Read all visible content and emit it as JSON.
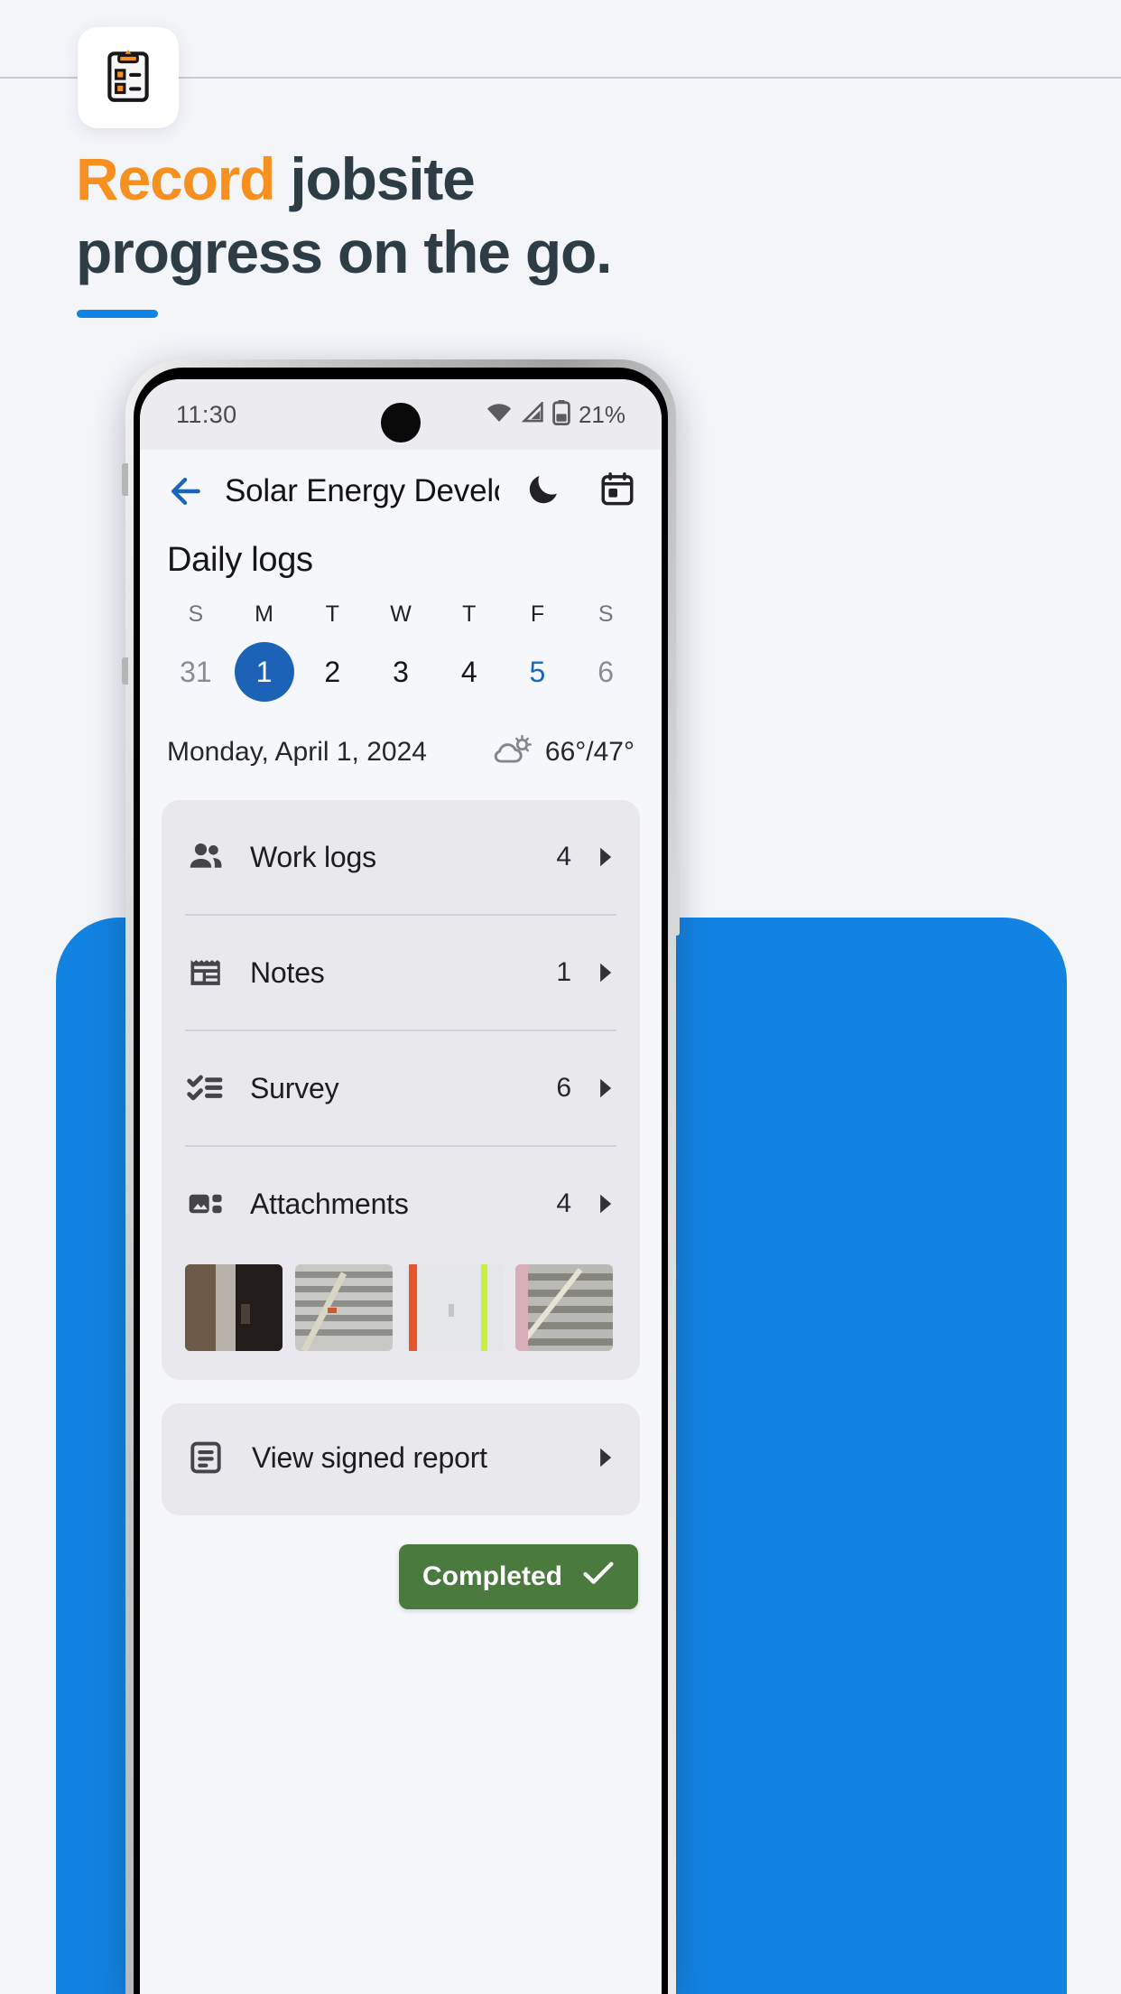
{
  "promo": {
    "app_icon": "clipboard-checklist-icon",
    "headline_accent": "Record",
    "headline_rest": " jobsite",
    "headline_line2": "progress on the go.",
    "accent_color": "#f7901e",
    "text_color": "#2d3c45",
    "rule_color": "#1283e2",
    "background_color": "#f4f5f9"
  },
  "statusbar": {
    "time": "11:30",
    "wifi_icon": "wifi-icon",
    "signal_icon": "signal-icon",
    "battery_icon": "battery-icon",
    "battery_percent": "21%"
  },
  "appbar": {
    "back_icon": "back-arrow-icon",
    "title": "Solar Energy Develop…",
    "dark_mode_icon": "moon-icon",
    "calendar_icon": "calendar-icon"
  },
  "screen": {
    "section_title": "Daily logs"
  },
  "calendar": {
    "days": [
      {
        "dow": "S",
        "num": "31",
        "state": "muted"
      },
      {
        "dow": "M",
        "num": "1",
        "state": "selected"
      },
      {
        "dow": "T",
        "num": "2",
        "state": "normal"
      },
      {
        "dow": "W",
        "num": "3",
        "state": "normal"
      },
      {
        "dow": "T",
        "num": "4",
        "state": "normal"
      },
      {
        "dow": "F",
        "num": "5",
        "state": "today"
      },
      {
        "dow": "S",
        "num": "6",
        "state": "muted"
      }
    ],
    "selected_color": "#1c63b8",
    "today_color": "#1768c4"
  },
  "date_row": {
    "date_text": "Monday, April 1, 2024",
    "weather_icon": "partly-cloudy-icon",
    "temperature": "66°/47°"
  },
  "log_rows": [
    {
      "icon": "people-icon",
      "label": "Work logs",
      "count": "4",
      "caret": "chevron-right-icon"
    },
    {
      "icon": "notes-icon",
      "label": "Notes",
      "count": "1",
      "caret": "chevron-right-icon"
    },
    {
      "icon": "checklist-icon",
      "label": "Survey",
      "count": "6",
      "caret": "chevron-right-icon"
    },
    {
      "icon": "image-grid-icon",
      "label": "Attachments",
      "count": "4",
      "caret": "chevron-right-icon"
    }
  ],
  "attachments_thumbnails": [
    {
      "name": "thumbnail-doorway"
    },
    {
      "name": "thumbnail-ceiling-duct"
    },
    {
      "name": "thumbnail-wall-pipe"
    },
    {
      "name": "thumbnail-scaffold"
    }
  ],
  "report_row": {
    "icon": "report-document-icon",
    "label": "View signed report",
    "caret": "chevron-right-icon"
  },
  "status_chip": {
    "label": "Completed",
    "check_icon": "check-icon",
    "color": "#4b7a3e"
  }
}
